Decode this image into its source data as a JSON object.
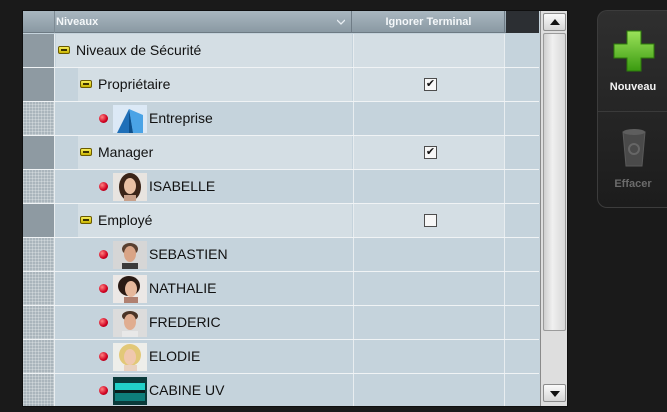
{
  "header": {
    "col_niveaux": "Niveaux",
    "col_ignorer": "Ignorer Terminal"
  },
  "tree": {
    "root": {
      "label": "Niveaux de Sécurité"
    },
    "groups": [
      {
        "label": "Propriétaire",
        "ignorer_checked": true
      },
      {
        "label": "Manager",
        "ignorer_checked": true
      },
      {
        "label": "Employé",
        "ignorer_checked": false
      }
    ],
    "users": [
      {
        "label": "Entreprise",
        "icon": "building-icon"
      },
      {
        "label": "ISABELLE",
        "icon": "user-photo-icon"
      },
      {
        "label": "SEBASTIEN",
        "icon": "user-photo-icon"
      },
      {
        "label": "NATHALIE",
        "icon": "user-photo-icon"
      },
      {
        "label": "FREDERIC",
        "icon": "user-photo-icon"
      },
      {
        "label": "ELODIE",
        "icon": "user-photo-icon"
      },
      {
        "label": "CABINE UV",
        "icon": "tanning-bed-icon"
      }
    ]
  },
  "toolbar": {
    "new_label": "Nouveau",
    "delete_label": "Effacer"
  },
  "colors": {
    "accent_green": "#62c21a",
    "row_bg": "#c5d3dc",
    "header_bg": "#8a99a3"
  }
}
